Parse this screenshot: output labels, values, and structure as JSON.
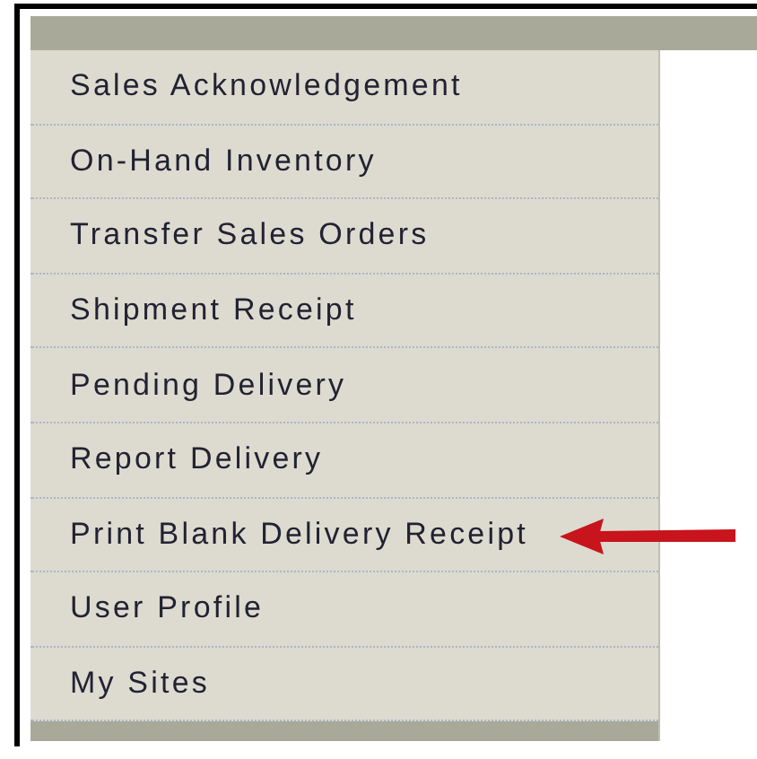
{
  "menu": {
    "items": [
      {
        "label": "Sales Acknowledgement"
      },
      {
        "label": "On-Hand Inventory"
      },
      {
        "label": "Transfer Sales Orders"
      },
      {
        "label": "Shipment Receipt"
      },
      {
        "label": "Pending Delivery"
      },
      {
        "label": "Report Delivery"
      },
      {
        "label": "Print Blank Delivery Receipt",
        "pointed": true
      },
      {
        "label": "User Profile"
      },
      {
        "label": "My Sites"
      }
    ]
  }
}
